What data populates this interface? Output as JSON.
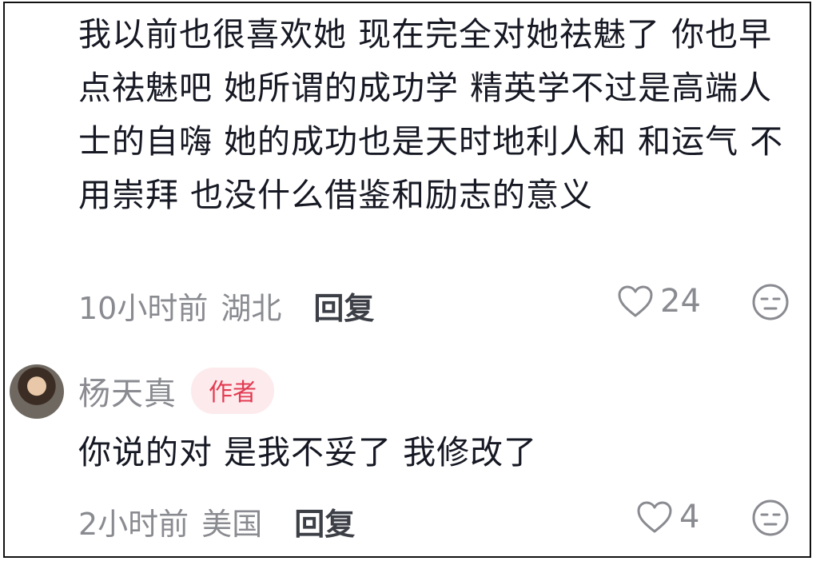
{
  "comments": [
    {
      "text": "我以前也很喜欢她 现在完全对她祛魅了 你也早点祛魅吧 她所谓的成功学 精英学不过是高端人士的自嗨 她的成功也是天时地利人和 和运气 不用崇拜 也没什么借鉴和励志的意义",
      "time": "10小时前",
      "location": "湖北",
      "reply_label": "回复",
      "likes": "24"
    },
    {
      "author": "杨天真",
      "badge": "作者",
      "text": "你说的对 是我不妥了 我修改了",
      "time": "2小时前",
      "location": "美国",
      "reply_label": "回复",
      "likes": "4"
    }
  ],
  "colors": {
    "text": "#161823",
    "meta": "#8a8b91",
    "badge_bg": "#fdeaec",
    "badge_text": "#e23b52"
  },
  "icons": {
    "like": "heart-outline-icon",
    "dislike": "unamused-face-icon"
  }
}
